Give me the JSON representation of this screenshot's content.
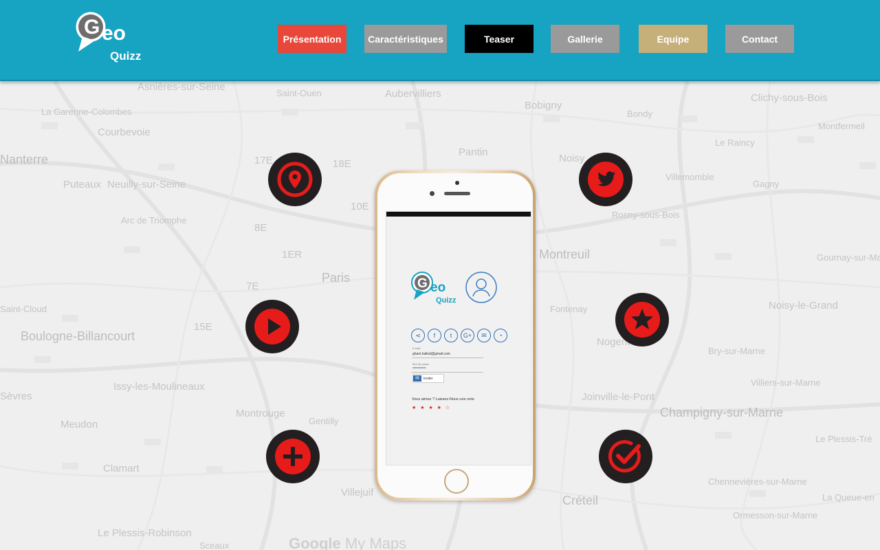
{
  "brand": {
    "logo_text_g": "G",
    "logo_text_eo": "eo",
    "logo_text_quizz": "Quizz"
  },
  "nav": [
    {
      "label": "Présentation",
      "color": "#e8473a"
    },
    {
      "label": "Caractéristiques",
      "color": "#9a9a9a"
    },
    {
      "label": "Teaser",
      "color": "#000000"
    },
    {
      "label": "Gallerie",
      "color": "#9a9a9a"
    },
    {
      "label": "Equipe",
      "color": "#c6b07a"
    },
    {
      "label": "Contact",
      "color": "#9a9a9a"
    }
  ],
  "map": {
    "places": [
      "Asnières-sur-Seine",
      "Saint-Ouen",
      "Aubervilliers",
      "Bobigny",
      "Bondy",
      "Clichy-sous-Bois",
      "La Garenne-Colombes",
      "Courbevoie",
      "Montfermeil",
      "Nanterre",
      "Pantin",
      "Noisy",
      "Le Raincy",
      "Puteaux",
      "Neuilly-sur-Seine",
      "Villemomble",
      "Gagny",
      "Rosny-sous-Bois",
      "Montreuil",
      "Gournay-sur-Marne",
      "Paris",
      "Noisy-le-Grand",
      "Saint-Cloud",
      "Boulogne-Billancourt",
      "Bry-sur-Marne",
      "Issy-les-Moulineaux",
      "Villiers-sur-Marne",
      "Sèvres",
      "Joinville-le-Pont",
      "Montrouge",
      "Gentilly",
      "Champigny-sur-Marne",
      "Meudon",
      "Le Plessis-Tré",
      "Clamart",
      "Chennevières-sur-Marne",
      "Villejuif",
      "Créteil",
      "Ormesson-sur-Marne",
      "Le Plessis-Robinson",
      "Sceaux",
      "La Queue-en",
      "Arc de Triomphe",
      "8E",
      "17E",
      "18E",
      "10E",
      "1ER",
      "7E",
      "15E",
      "Nogent",
      "Fontenay"
    ],
    "attribution": "Google My Maps",
    "attribution_google": "Google",
    "attribution_rest": " My Maps"
  },
  "features": [
    {
      "icon": "location-pin-icon"
    },
    {
      "icon": "twitter-icon"
    },
    {
      "icon": "play-icon"
    },
    {
      "icon": "star-icon"
    },
    {
      "icon": "plus-icon"
    },
    {
      "icon": "check-icon"
    }
  ],
  "phone_app": {
    "email_label": "E-mail",
    "email_value": "ghani.halled@gmail.com",
    "password_label": "Mot de passe",
    "password_value": "**********",
    "invite_label": "Inviter",
    "rate_text": "Vous aimez ? Laissez-Nous une note",
    "stars": "★ ★ ★ ★ ☆",
    "share_icons": [
      "share-icon",
      "facebook-icon",
      "twitter-icon",
      "google-plus-icon",
      "mail-icon",
      "rss-icon"
    ]
  }
}
